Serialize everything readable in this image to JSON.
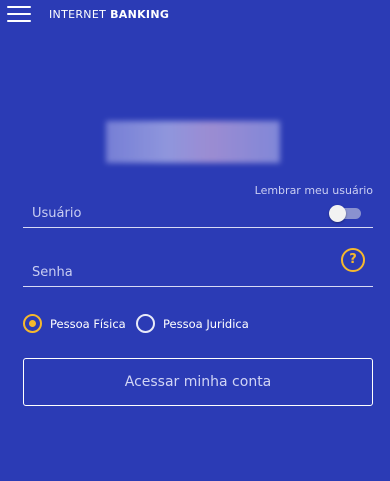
{
  "header": {
    "title_light": "INTERNET",
    "title_bold": "BANKING",
    "menu_icon": "hamburger-menu-icon"
  },
  "login": {
    "remember_label": "Lembrar meu usuário",
    "remember_enabled": false,
    "username_label": "Usuário",
    "password_label": "Senha",
    "help_icon": "question-mark-icon",
    "help_glyph": "?",
    "person_types": [
      {
        "label": "Pessoa Física",
        "selected": true
      },
      {
        "label": "Pessoa Juridica",
        "selected": false
      }
    ],
    "submit_label": "Acessar minha conta"
  },
  "colors": {
    "background": "#2b3bb5",
    "accent": "#f5b82e",
    "text": "#ffffff"
  }
}
